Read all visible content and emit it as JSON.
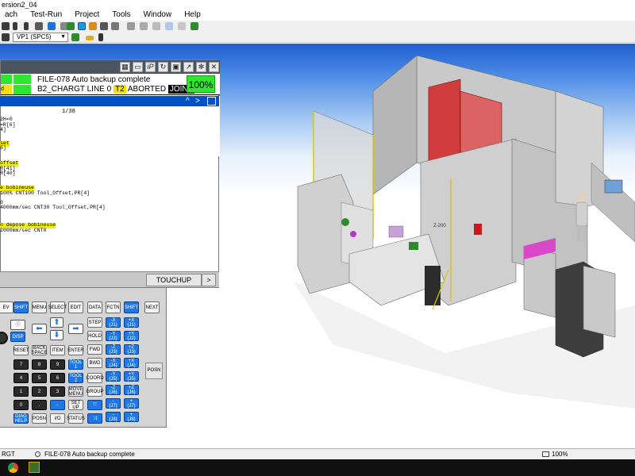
{
  "window": {
    "title": "ersion2_04"
  },
  "menu": [
    "ach",
    "Test-Run",
    "Project",
    "Tools",
    "Window",
    "Help"
  ],
  "toolbar": {
    "viewport_select": "VP1 (SPC5)"
  },
  "pendant": {
    "status_line1": "FILE-078 Auto backup complete",
    "status_line2_prefix": "B2_CHARGT LINE 0",
    "status_t2": "T2",
    "status_aborted": "ABORTED",
    "status_joint": "JOINT",
    "override": "100%",
    "led_labels": [
      "",
      "",
      "d",
      ""
    ],
    "page_indicator": "1/38",
    "program_lines": [
      {
        "text": "2H=0",
        "hl": false
      },
      {
        "text": "=R[6]",
        "hl": false
      },
      {
        "text": "4]",
        "hl": false
      },
      {
        "text": "",
        "hl": false
      },
      {
        "text": "set",
        "hl": true
      },
      {
        "text": "5]",
        "hl": false
      },
      {
        "text": "",
        "hl": false
      },
      {
        "text": "offset",
        "hl": true
      },
      {
        "text": "R[41]",
        "hl": false
      },
      {
        "text": "R[40]",
        "hl": false
      },
      {
        "text": "",
        "hl": false
      },
      {
        "text": "e bobineuse",
        "hl": true
      },
      {
        "text": "100% CNT100 Tool_Offset,PR[4]",
        "hl": false
      },
      {
        "text": "",
        "hl": false
      },
      {
        "text": "0",
        "hl": false
      },
      {
        "text": "4000mm/sec CNT30 Tool_Offset,PR[4]",
        "hl": false
      },
      {
        "text": "",
        "hl": false
      },
      {
        "text": "n depose bobineuse",
        "hl": true
      },
      {
        "text": "2000mm/sec CNT0",
        "hl": false
      }
    ],
    "softkeys": {
      "touchup": "TOUCHUP",
      "next": ">"
    }
  },
  "keypad": {
    "row1": [
      "EV",
      "SHIFT",
      "MENU",
      "SELECT",
      "EDIT",
      "DATA",
      "FCTN",
      "SHIFT",
      "NEXT"
    ],
    "disp": "DISP",
    "step": "STEP",
    "hold": "HOLD",
    "fwd": "FWD",
    "bwd": "BWD",
    "reset": "RESET",
    "backspace": "BACK SPACE",
    "item": "ITEM",
    "enter": "ENTER",
    "tool1": "TOOL 1",
    "tool2": "TOOL 2",
    "coord": "COORD",
    "move_menu": "MOVE MENU",
    "group": "GROUP",
    "setup": "SET UP",
    "diag_help": "DIAG HELP",
    "posn": "POSN",
    "io": "I/O",
    "status": "STATUS",
    "digits": [
      "7",
      "8",
      "9",
      "4",
      "5",
      "6",
      "1",
      "2",
      "3",
      "0",
      "."
    ],
    "jog_minus": [
      "-X\n(J1)",
      "-Y\n(J2)",
      "-Z\n(J3)",
      "-X\n(J4)",
      "-Y\n(J5)",
      "-Z\n(J6)",
      "-\n(J7)",
      "-\n(J8)"
    ],
    "jog_plus": [
      "+X\n(J1)",
      "+Y\n(J2)",
      "+Z\n(J3)",
      "+X\n(J4)",
      "+Y\n(J5)",
      "+Z\n(J6)",
      "+\n(J7)",
      "+\n(J8)"
    ],
    "posn_side": "POSN"
  },
  "scene": {
    "label": "Z-200"
  },
  "statusbar": {
    "left": "RGT",
    "message": "FILE-078 Auto backup complete",
    "zoom": "100%"
  }
}
